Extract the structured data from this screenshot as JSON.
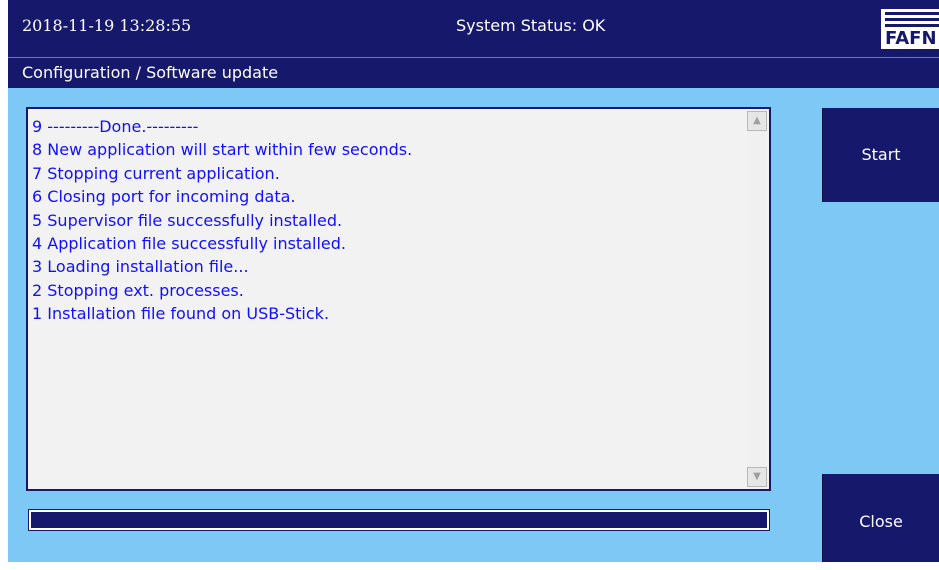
{
  "header": {
    "datetime": "2018-11-19  13:28:55",
    "status": "System Status: OK",
    "logo_text": "FAFN"
  },
  "breadcrumb": "Configuration / Software update",
  "log": {
    "lines": [
      "9 ---------Done.---------",
      "8 New application will start within few seconds.",
      "7 Stopping current application.",
      "6 Closing port for incoming data.",
      "5 Supervisor file successfully installed.",
      "4 Application file successfully installed.",
      "3 Loading installation file...",
      "2 Stopping ext. processes.",
      "1 Installation file found on USB-Stick."
    ],
    "scroll_up": "▲",
    "scroll_down": "▼"
  },
  "progress": {
    "fraction": 1.0
  },
  "buttons": {
    "start": "Start",
    "close": "Close"
  },
  "colors": {
    "header_bg": "#16186c",
    "content_bg": "#7ec8f6",
    "log_text": "#1010ff"
  }
}
